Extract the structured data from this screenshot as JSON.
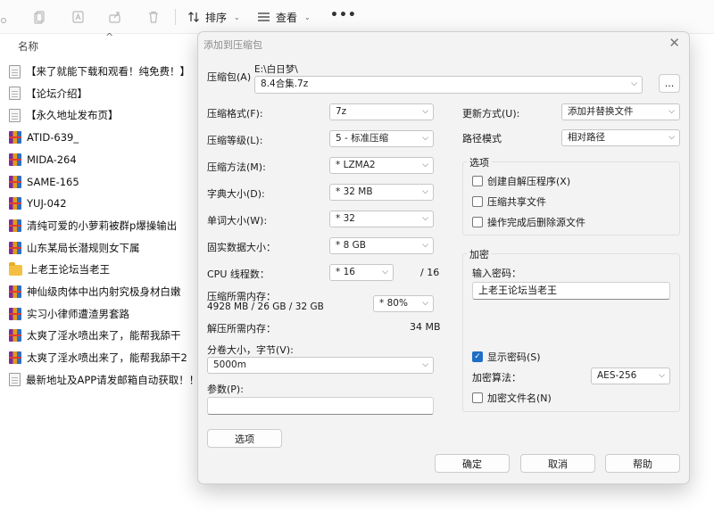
{
  "toolbar": {
    "sort_label": "排序",
    "view_label": "查看",
    "more_label": "•••"
  },
  "file_list": {
    "column_header": "名称",
    "files": [
      {
        "name": "【来了就能下载和观看！纯免费！】",
        "icon": "document-icon"
      },
      {
        "name": "【论坛介绍】",
        "icon": "document-icon"
      },
      {
        "name": "【永久地址发布页】",
        "icon": "document-icon"
      },
      {
        "name": "ATID-639_",
        "icon": "rar-archive-icon"
      },
      {
        "name": "MIDA-264",
        "icon": "rar-archive-icon"
      },
      {
        "name": "SAME-165",
        "icon": "rar-archive-icon"
      },
      {
        "name": "YUJ-042",
        "icon": "rar-archive-icon"
      },
      {
        "name": "清纯可爱的小萝莉被群p爆操输出",
        "icon": "rar-archive-icon"
      },
      {
        "name": "山东某局长潜规则女下属",
        "icon": "rar-archive-icon"
      },
      {
        "name": "上老王论坛当老王",
        "icon": "folder-icon"
      },
      {
        "name": "神仙级肉体中出内射究极身材白嫩",
        "icon": "rar-archive-icon"
      },
      {
        "name": "实习小律师遭渣男套路",
        "icon": "rar-archive-icon"
      },
      {
        "name": "太爽了淫水喷出来了，能帮我舔干",
        "icon": "rar-archive-icon"
      },
      {
        "name": "太爽了淫水喷出来了，能帮我舔干2",
        "icon": "rar-archive-icon"
      },
      {
        "name": "最新地址及APP请发邮箱自动获取！！！",
        "icon": "document-icon"
      }
    ]
  },
  "dialog": {
    "title": "添加到压缩包",
    "close_label": "✕",
    "archive_label": "压缩包(A)",
    "archive_path": "E:\\白日梦\\",
    "archive_name": "8.4合集.7z",
    "browse_label": "...",
    "format_label": "压缩格式(F):",
    "format_value": "7z",
    "level_label": "压缩等级(L):",
    "level_value": "5 - 标准压缩",
    "method_label": "压缩方法(M):",
    "method_value": "* LZMA2",
    "dict_label": "字典大小(D):",
    "dict_value": "* 32 MB",
    "word_label": "单词大小(W):",
    "word_value": "* 32",
    "solid_label": "固实数据大小：",
    "solid_value": "* 8 GB",
    "threads_label": "CPU 线程数：",
    "threads_value": "* 16",
    "threads_total": "/ 16",
    "mem_comp_label": "压缩所需内存：",
    "mem_comp_detail": "4928 MB / 26 GB / 32 GB",
    "mem_comp_percent": "* 80%",
    "mem_decomp_label": "解压所需内存：",
    "mem_decomp_value": "34 MB",
    "split_label": "分卷大小，字节(V):",
    "split_value": "5000m",
    "params_label": "参数(P):",
    "params_value": "",
    "update_label": "更新方式(U):",
    "update_value": "添加并替换文件",
    "pathmode_label": "路径模式",
    "pathmode_value": "相对路径",
    "options_title": "选项",
    "opt_sfx": "创建自解压程序(X)",
    "opt_shared": "压缩共享文件",
    "opt_delete": "操作完成后删除源文件",
    "encrypt_title": "加密",
    "password_label": "输入密码：",
    "password_value": "上老王论坛当老王",
    "show_password": "显示密码(S)",
    "enc_method_label": "加密算法：",
    "enc_method_value": "AES-256",
    "enc_names": "加密文件名(N)",
    "options_button": "选项",
    "ok_button": "确定",
    "cancel_button": "取消",
    "help_button": "帮助"
  }
}
